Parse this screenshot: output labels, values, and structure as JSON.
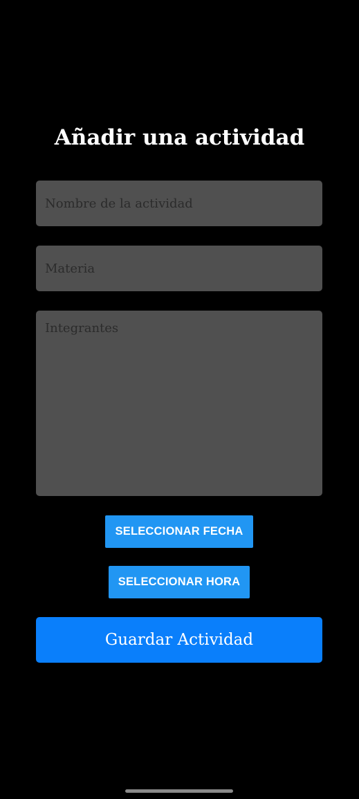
{
  "screen": {
    "title": "Añadir una actividad"
  },
  "form": {
    "name_placeholder": "Nombre de la actividad",
    "subject_placeholder": "Materia",
    "members_placeholder": "Integrantes",
    "name_value": "",
    "subject_value": "",
    "members_value": ""
  },
  "buttons": {
    "select_date_label": "SELECCIONAR FECHA",
    "select_time_label": "SELECCIONAR HORA",
    "save_label": "Guardar Actividad"
  },
  "colors": {
    "background": "#000000",
    "field_background": "#505050",
    "secondary_button": "#2196f3",
    "primary_button": "#0a7ffb",
    "title_text": "#ffffff"
  }
}
